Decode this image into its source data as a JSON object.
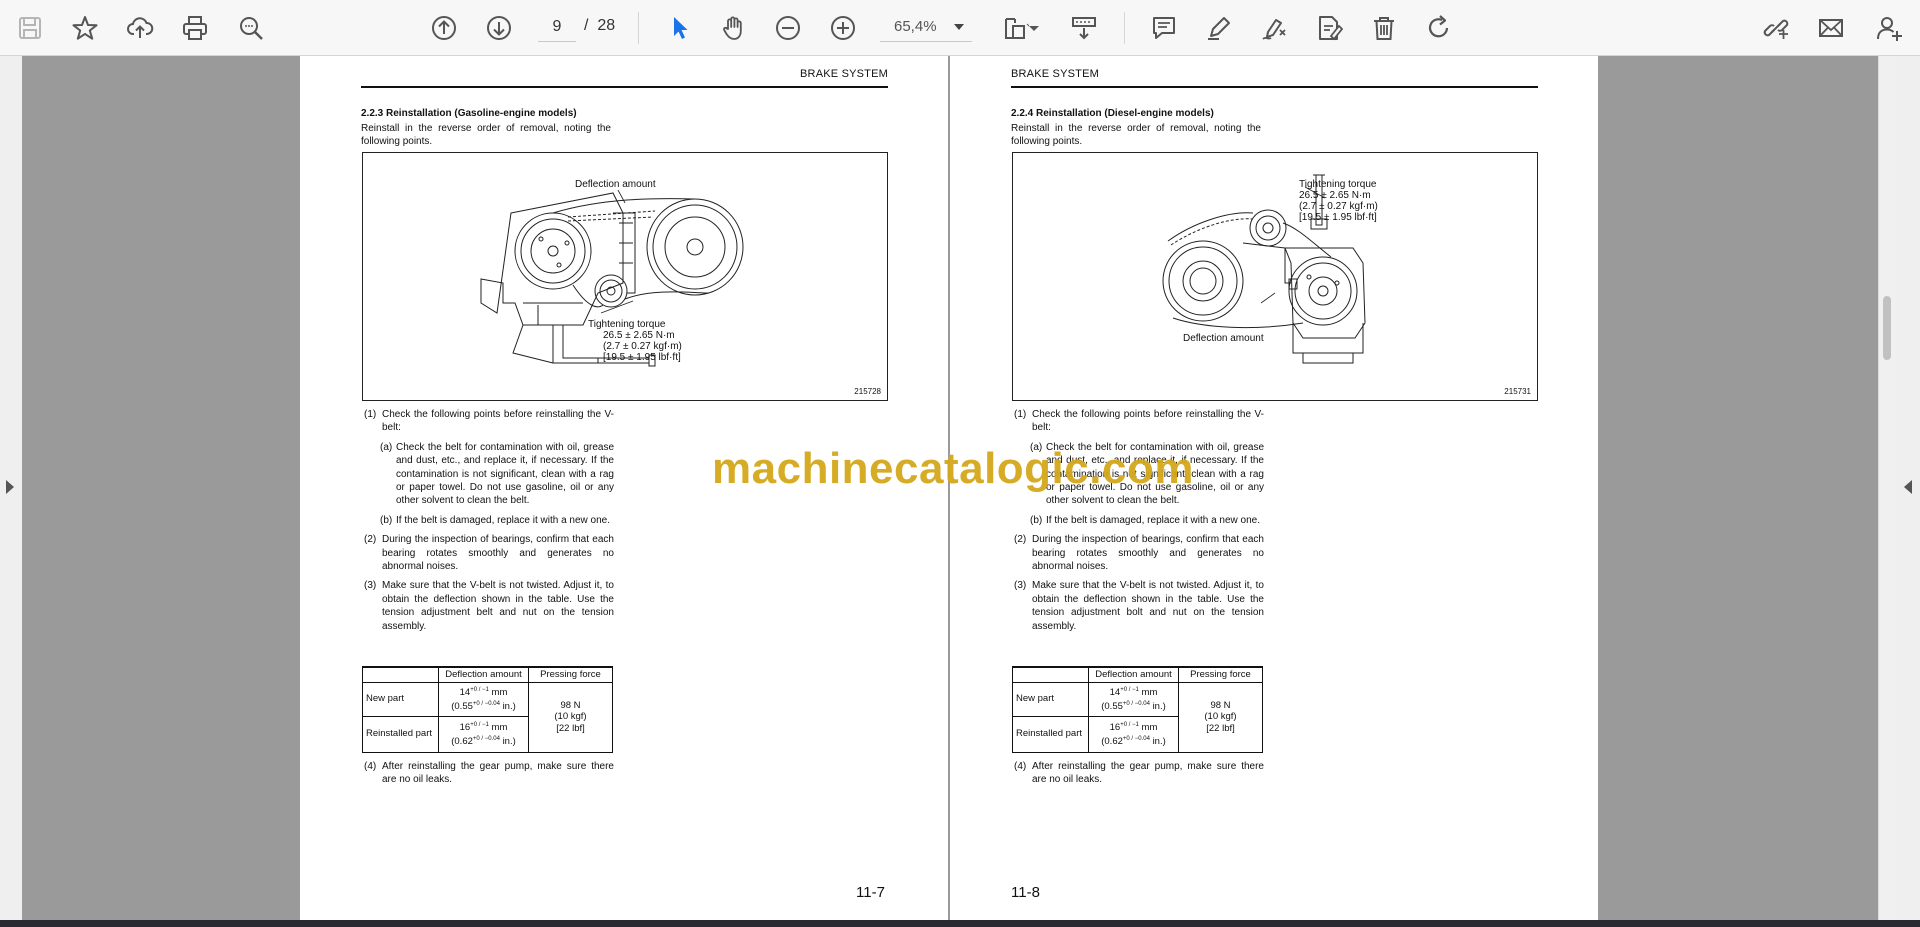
{
  "toolbar": {
    "page_current": "9",
    "page_separator": "/",
    "page_total": "28",
    "zoom": "65,4%"
  },
  "watermark": "machinecatalogic.com",
  "left_page": {
    "header": "BRAKE SYSTEM",
    "section_title": "2.2.3   Reinstallation (Gasoline-engine models)",
    "intro": "Reinstall in the reverse order of removal, noting the following points.",
    "fig_labels": {
      "deflection": "Deflection amount",
      "torque_title": "Tightening torque",
      "torque_1": "26.5 ± 2.65 N·m",
      "torque_2": "(2.7 ± 0.27 kgf·m)",
      "torque_3": "[19.5 ± 1.95 lbf·ft]"
    },
    "fig_number": "215728",
    "page_number": "11-7"
  },
  "right_page": {
    "header": "BRAKE SYSTEM",
    "section_title": "2.2.4   Reinstallation (Diesel-engine models)",
    "intro": "Reinstall in the reverse order of removal, noting the following points.",
    "fig_labels": {
      "deflection": "Deflection amount",
      "torque_title": "Tightening torque",
      "torque_1": "26.5 ± 2.65 N·m",
      "torque_2": "(2.7 ± 0.27 kgf·m)",
      "torque_3": "[19.5 ± 1.95 lbf·ft]"
    },
    "fig_number": "215731",
    "page_number": "11-8"
  },
  "steps": {
    "s1_num": "(1)",
    "s1": "Check the following points before reinstalling the V-belt:",
    "s1a_num": "(a)",
    "s1a": "Check the belt for contamination with oil, grease and dust, etc., and replace it, if necessary. If the contamination is not significant, clean with a rag or paper towel. Do not use gasoline, oil or any other solvent to clean the belt.",
    "s1b_num": "(b)",
    "s1b": "If the belt is damaged, replace it with a new one.",
    "s2_num": "(2)",
    "s2": "During the inspection of bearings, confirm that each bearing rotates smoothly and generates no abnormal noises.",
    "s3_num": "(3)",
    "s3_left": "Make sure that the V-belt is not twisted. Adjust it, to obtain the deflection shown in the table. Use the tension adjustment belt and nut on the tension assembly.",
    "s3_right": "Make sure that the V-belt is not twisted. Adjust it, to obtain the deflection shown in the table. Use the tension adjustment bolt and nut on the tension assembly.",
    "s4_num": "(4)",
    "s4": "After reinstalling the gear pump, make sure there are no oil leaks."
  },
  "table": {
    "col1": "Deflection amount",
    "col2": "Pressing force",
    "row1_label": "New part",
    "row1_mm": "14",
    "row1_mm_tol": "+0 / −1",
    "row1_mm_unit": "mm",
    "row1_in": "(0.55",
    "row1_in_tol": "+0 / −0.04",
    "row1_in_unit": "in.)",
    "row2_label": "Reinstalled part",
    "row2_mm": "16",
    "row2_mm_tol": "+0 / −1",
    "row2_mm_unit": "mm",
    "row2_in": "(0.62",
    "row2_in_tol": "+0 / −0.04",
    "row2_in_unit": "in.)",
    "force_1": "98 N",
    "force_2": "(10 kgf)",
    "force_3": "[22 lbf]"
  }
}
